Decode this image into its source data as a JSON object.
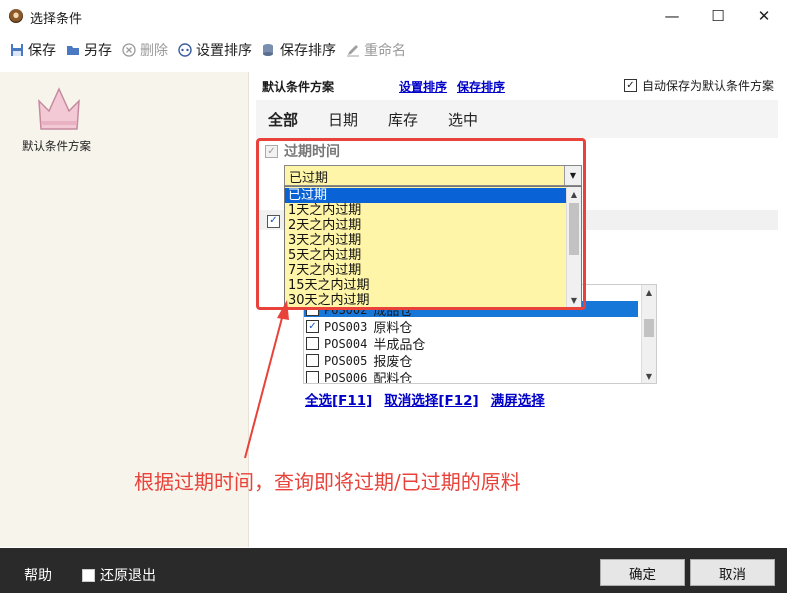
{
  "window": {
    "title": "选择条件",
    "minimize_glyph": "—",
    "maximize_glyph": "☐",
    "close_glyph": "✕"
  },
  "toolbar": {
    "items": [
      {
        "label": "保存",
        "icon": "save-icon",
        "enabled": true
      },
      {
        "label": "另存",
        "icon": "folder-open-icon",
        "enabled": true
      },
      {
        "label": "删除",
        "icon": "delete-icon",
        "enabled": false
      },
      {
        "label": "设置排序",
        "icon": "sort-settings-icon",
        "enabled": true
      },
      {
        "label": "保存排序",
        "icon": "database-save-icon",
        "enabled": true
      },
      {
        "label": "重命名",
        "icon": "pencil-icon",
        "enabled": false
      }
    ]
  },
  "left": {
    "scheme_label": "默认条件方案"
  },
  "header": {
    "title": "默认条件方案",
    "set_sort_link": "设置排序",
    "save_sort_link": "保存排序",
    "autosave_label": "自动保存为默认条件方案",
    "autosave_checked": true
  },
  "tabs": [
    "全部",
    "日期",
    "库存",
    "选中"
  ],
  "expiry": {
    "label": "过期时间",
    "selected": "已过期",
    "options": [
      "已过期",
      "1天之内过期",
      "2天之内过期",
      "3天之内过期",
      "5天之内过期",
      "7天之内过期",
      "15天之内过期",
      "30天之内过期"
    ]
  },
  "warehouse_list": {
    "rows": [
      {
        "code": "POS002",
        "name": "成品仓",
        "checked": false
      },
      {
        "code": "POS003",
        "name": "原料仓",
        "checked": true
      },
      {
        "code": "POS004",
        "name": "半成品仓",
        "checked": false
      },
      {
        "code": "POS005",
        "name": "报废仓",
        "checked": false
      },
      {
        "code": "POS006",
        "name": "配料仓",
        "checked": false
      }
    ]
  },
  "list_links": {
    "select_all": "全选[F11]",
    "deselect": "取消选择[F12]",
    "fullscreen": "满屏选择"
  },
  "annotation": "根据过期时间，查询即将过期/已过期的原料",
  "footer": {
    "help": "帮助",
    "restore_exit": "还原退出",
    "ok": "确定",
    "cancel": "取消"
  },
  "colors": {
    "accent_red": "#e8423a",
    "selection_blue": "#0a63d6",
    "dropdown_bg": "#fff5a8",
    "link_blue": "#0000c8"
  }
}
